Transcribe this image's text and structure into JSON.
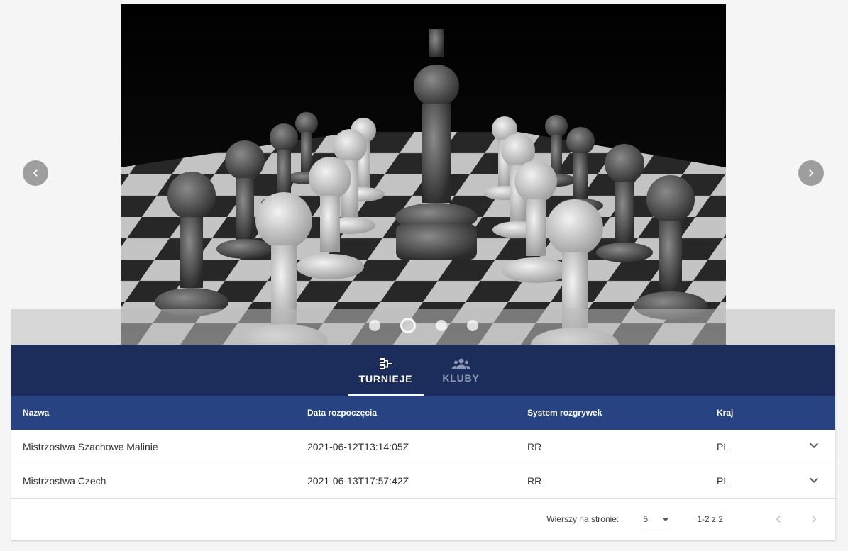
{
  "carousel": {
    "slide_description": "chess-pieces-photo",
    "slide_count": 4,
    "active_index": 1
  },
  "tabs": [
    {
      "label": "TURNIEJE",
      "icon": "bracket-icon",
      "active": true
    },
    {
      "label": "KLUBY",
      "icon": "group-icon",
      "active": false
    }
  ],
  "table": {
    "headers": [
      "Nazwa",
      "Data rozpoczęcia",
      "System rozgrywek",
      "Kraj"
    ],
    "rows": [
      [
        "Mistrzostwa Szachowe Malinie",
        "2021-06-12T13:14:05Z",
        "RR",
        "PL"
      ],
      [
        "Mistrzostwa Czech",
        "2021-06-13T17:57:42Z",
        "RR",
        "PL"
      ]
    ]
  },
  "pagination": {
    "rows_label": "Wierszy na stronie:",
    "rows_value": "5",
    "range": "1-2 z 2"
  },
  "colors": {
    "tabs_bg": "#1c2d5b",
    "header_bg": "#284382"
  }
}
